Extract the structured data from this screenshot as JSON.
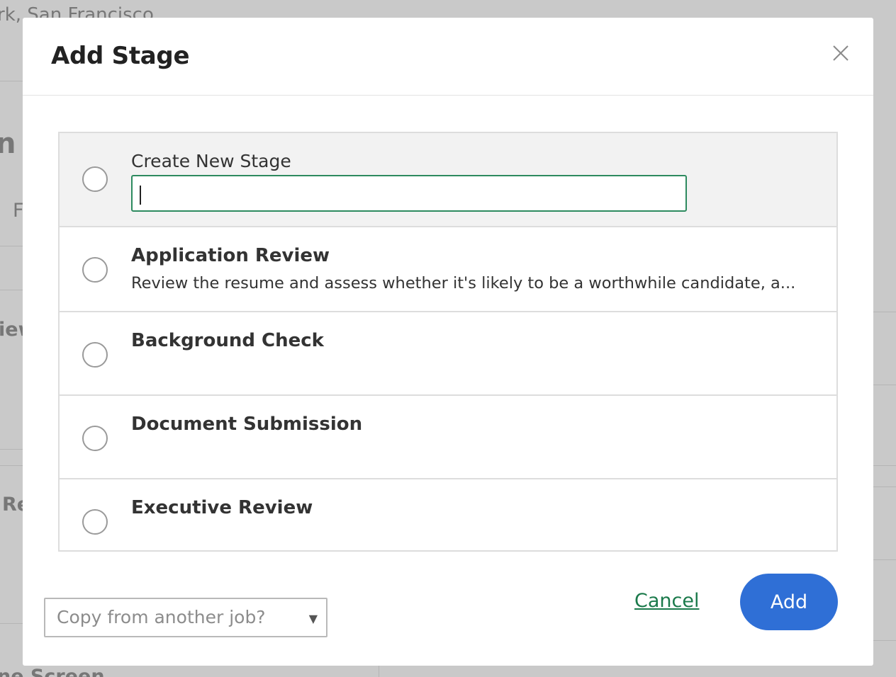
{
  "background": {
    "fragments": [
      "rk, San Francisco",
      "n",
      "F",
      "iew",
      "Re",
      "ne Screen"
    ]
  },
  "modal": {
    "title": "Add Stage"
  },
  "new_stage": {
    "label": "Create New Stage",
    "value": ""
  },
  "stages": [
    {
      "title": "Application Review",
      "description": "Review the resume and assess whether it's likely to be a worthwhile candidate, a..."
    },
    {
      "title": "Background Check",
      "description": ""
    },
    {
      "title": "Document Submission",
      "description": ""
    },
    {
      "title": "Executive Review",
      "description": ""
    }
  ],
  "footer": {
    "copy_placeholder": "Copy from another job?",
    "cancel_label": "Cancel",
    "add_label": "Add"
  },
  "colors": {
    "accent_green": "#2d8a5f",
    "link_green": "#1b7a4b",
    "primary_blue": "#2f6fd6",
    "overlay_gray": "#c9c9c9"
  }
}
